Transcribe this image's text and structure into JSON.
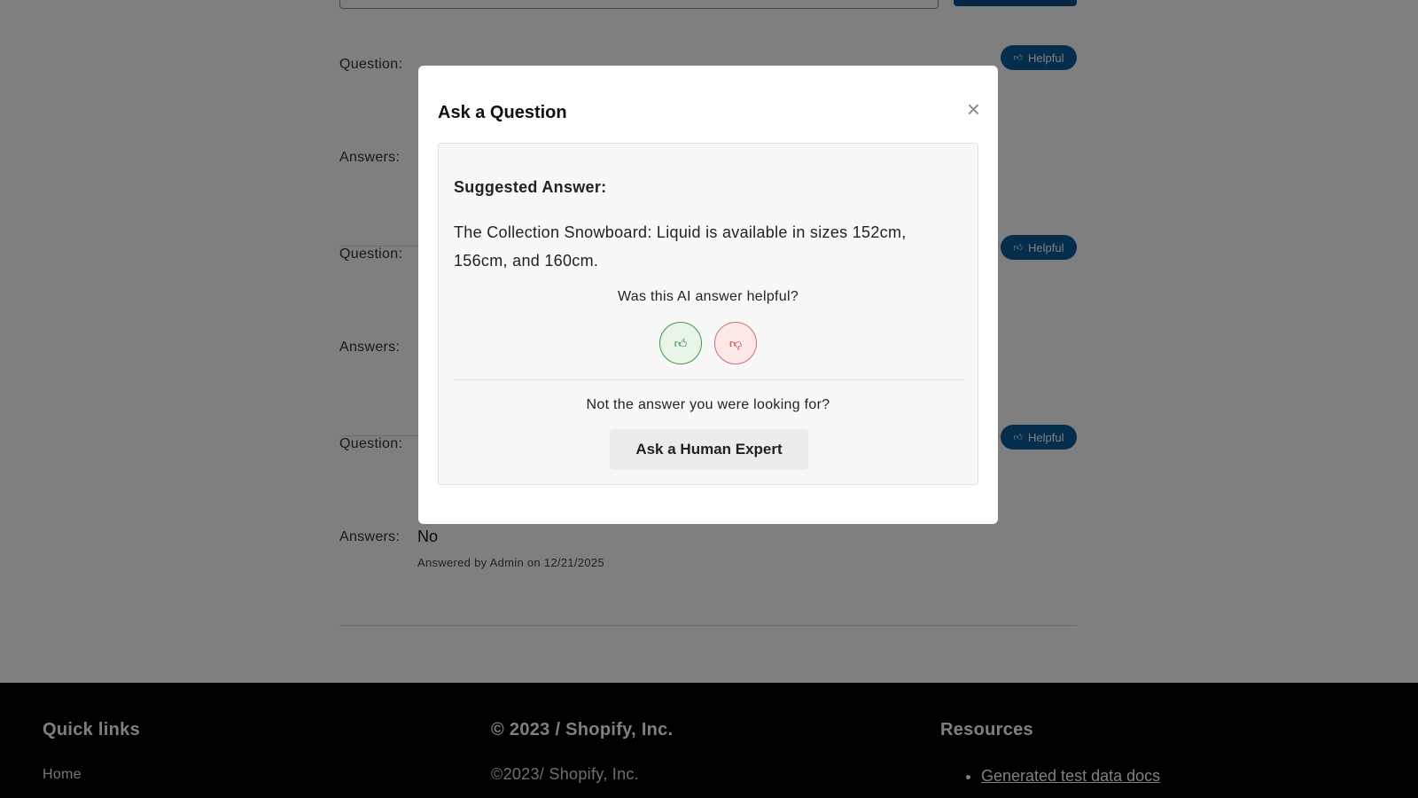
{
  "qa": {
    "question_label": "Question:",
    "answers_label": "Answers:",
    "helpful_label": "Helpful",
    "items": [
      {
        "answer": "",
        "meta": ""
      },
      {
        "answer": "",
        "meta": ""
      },
      {
        "answer": "No",
        "meta": "Answered by Admin on 12/21/2025"
      }
    ]
  },
  "modal": {
    "title": "Ask a Question",
    "close_symbol": "×",
    "suggested_heading": "Suggested Answer:",
    "suggested_text": "The Collection Snowboard: Liquid is available in sizes 152cm, 156cm, and 160cm.",
    "helpful_prompt": "Was this AI answer helpful?",
    "thumbs_up_icon": "thumbs-up-icon",
    "thumbs_down_icon": "thumbs-down-icon",
    "not_answer_text": "Not the answer you were looking for?",
    "expert_button": "Ask a Human Expert"
  },
  "footer": {
    "quick_links_heading": "Quick links",
    "quick_links": [
      "Home"
    ],
    "copyright_heading": "© 2023 / Shopify, Inc.",
    "copyright_small": "©2023/ Shopify, Inc.",
    "resources_heading": "Resources",
    "resources": [
      "Generated test data docs"
    ]
  },
  "colors": {
    "helpful_button": "#0b5a99",
    "overlay": "rgba(0,0,0,0.5)",
    "vote_up": "#3c9a3c",
    "vote_down": "#c21d1d"
  }
}
